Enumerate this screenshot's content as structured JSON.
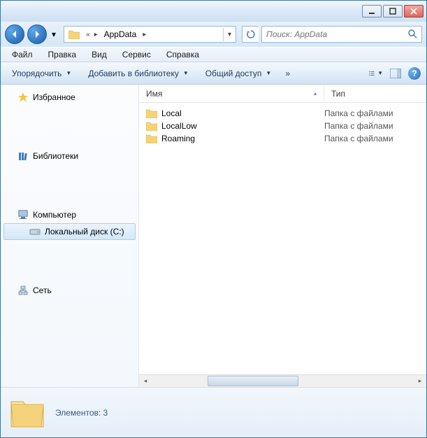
{
  "titlebar": {
    "minimize": "min",
    "maximize": "max",
    "close": "close"
  },
  "nav": {
    "back": "Back",
    "forward": "Forward",
    "breadcrumb_ellipsis": "«",
    "breadcrumb_current": "AppData",
    "refresh": "Refresh"
  },
  "search": {
    "placeholder": "Поиск: AppData"
  },
  "menubar": {
    "file": "Файл",
    "edit": "Правка",
    "view": "Вид",
    "tools": "Сервис",
    "help": "Справка"
  },
  "toolbar": {
    "organize": "Упорядочить",
    "include": "Добавить в библиотеку",
    "share": "Общий доступ",
    "overflow": "»"
  },
  "navpane": {
    "favorites": "Избранное",
    "libraries": "Библиотеки",
    "computer": "Компьютер",
    "localdisk": "Локальный диск (C:)",
    "network": "Сеть"
  },
  "columns": {
    "name": "Имя",
    "type": "Тип"
  },
  "files": [
    {
      "name": "Local",
      "type": "Папка с файлами"
    },
    {
      "name": "LocalLow",
      "type": "Папка с файлами"
    },
    {
      "name": "Roaming",
      "type": "Папка с файлами"
    }
  ],
  "details": {
    "count_label": "Элементов: 3"
  }
}
